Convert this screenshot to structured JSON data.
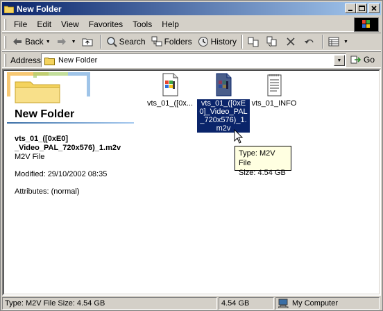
{
  "window": {
    "title": "New Folder",
    "caption_buttons": {
      "minimize": "_",
      "maximize": "□",
      "close": "✕"
    }
  },
  "menubar": {
    "items": [
      "File",
      "Edit",
      "View",
      "Favorites",
      "Tools",
      "Help"
    ]
  },
  "toolbar": {
    "back_label": "Back",
    "search_label": "Search",
    "folders_label": "Folders",
    "history_label": "History"
  },
  "address": {
    "label": "Address",
    "value": "New Folder",
    "go_label": "Go"
  },
  "panel": {
    "folder_title": "New Folder",
    "selected_name": "vts_01_([0xE0] _Video_PAL_720x576)_1.m2v",
    "selected_type": "M2V File",
    "modified": "Modified: 29/10/2002 08:35",
    "attributes": "Attributes: (normal)"
  },
  "files": [
    {
      "name": "vts_01_([0x...",
      "icon": "video-file-icon",
      "selected": false
    },
    {
      "name": "vts_01_([0xE0]_Video_PAL_720x576)_1.m2v",
      "icon": "video-file-icon",
      "selected": true
    },
    {
      "name": "vts_01_INFO",
      "icon": "text-file-icon",
      "selected": false
    }
  ],
  "tooltip": {
    "type_line": "Type: M2V File",
    "size_line": "Size: 4.54 GB"
  },
  "statusbar": {
    "description": "Type: M2V File Size: 4.54 GB",
    "size": "4.54 GB",
    "zone": "My Computer"
  },
  "colors": {
    "title_gradient_start": "#0a246a",
    "title_gradient_end": "#a6caf0",
    "selection": "#0a246a",
    "tooltip_bg": "#ffffe1",
    "chrome": "#d4d0c8"
  }
}
